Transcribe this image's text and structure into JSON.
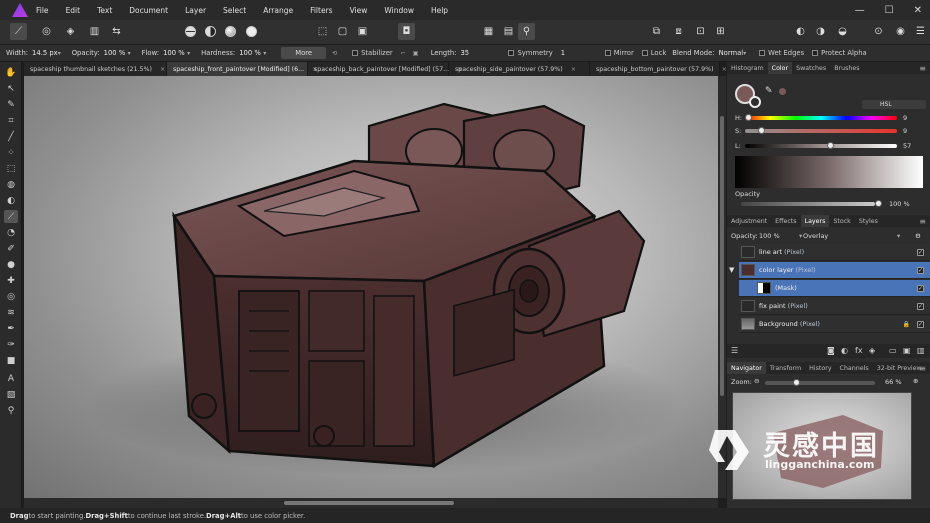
{
  "menu": [
    "File",
    "Edit",
    "Text",
    "Document",
    "Layer",
    "Select",
    "Arrange",
    "Filters",
    "View",
    "Window",
    "Help"
  ],
  "window_controls": [
    "—",
    "☐",
    "✕"
  ],
  "context": {
    "width_label": "Width:",
    "width_value": "14.5 px",
    "opacity_label": "Opacity:",
    "opacity_value": "100 %",
    "flow_label": "Flow:",
    "flow_value": "100 %",
    "hardness_label": "Hardness:",
    "hardness_value": "100 %",
    "more_label": "More",
    "stabilizer_label": "Stabilizer",
    "length_label": "Length:",
    "length_value": "35",
    "symmetry_label": "Symmetry",
    "symmetry_value": "1",
    "mirror_label": "Mirror",
    "lock_label": "Lock",
    "blend_label": "Blend Mode:",
    "blend_value": "Normal",
    "wet_edges_label": "Wet Edges",
    "protect_alpha_label": "Protect Alpha"
  },
  "tabs": [
    {
      "label": "spaceship thumbnail sketches (21.5%)",
      "active": false
    },
    {
      "label": "spaceship_front_paintover [Modified] (6...",
      "active": true
    },
    {
      "label": "spaceship_back_paintover [Modified] (57...",
      "active": false
    },
    {
      "label": "spaceship_side_paintover (57.9%)",
      "active": false
    },
    {
      "label": "spaceship_bottom_paintover (57.9%)",
      "active": false
    }
  ],
  "tab_close": "×",
  "status": {
    "part1_bold": "Drag",
    "part1": " to start painting. ",
    "part2_bold": "Drag+Shift",
    "part2": " to continue last stroke. ",
    "part3_bold": "Drag+Alt",
    "part3": " to use color picker."
  },
  "color_panel": {
    "tabs": [
      "Histogram",
      "Color",
      "Swatches",
      "Brushes"
    ],
    "active_tab": "Color",
    "model": "HSL",
    "h_label": "H:",
    "h_value": "9",
    "s_label": "S:",
    "s_value": "9",
    "l_label": "L:",
    "l_value": "57",
    "opacity_label": "Opacity",
    "opacity_value": "100 %",
    "fill_color": "#7a5a58",
    "h_fraction": 0.025,
    "s_fraction": 0.09,
    "l_fraction": 0.57
  },
  "layers_panel": {
    "tabs": [
      "Adjustment",
      "Effects",
      "Layers",
      "Stock",
      "Styles"
    ],
    "active_tab": "Layers",
    "opacity_label": "Opacity:",
    "opacity_value": "100 %",
    "blend_value": "Overlay",
    "layers": [
      {
        "name": "line art",
        "type": " (Pixel)",
        "selected": false,
        "indent": false,
        "locked": false
      },
      {
        "name": "color layer",
        "type": " (Pixel)",
        "selected": true,
        "indent": false,
        "locked": false
      },
      {
        "name": "(Mask)",
        "type": "",
        "selected": true,
        "indent": true,
        "locked": false
      },
      {
        "name": "fix paint",
        "type": " (Pixel)",
        "selected": false,
        "indent": false,
        "locked": false
      },
      {
        "name": "Background",
        "type": " (Pixel)",
        "selected": false,
        "indent": false,
        "locked": true
      }
    ]
  },
  "navigator_panel": {
    "tabs": [
      "Navigator",
      "Transform",
      "History",
      "Channels",
      "32-bit Preview"
    ],
    "active_tab": "Navigator",
    "zoom_label": "Zoom:",
    "zoom_value": "66 %"
  },
  "watermark": {
    "cn": "灵感中国",
    "en": "lingganchina.com"
  },
  "colors": {
    "accent": "#4a74b8",
    "ship": "#5a3a3a",
    "ship_dark": "#3b2424"
  }
}
